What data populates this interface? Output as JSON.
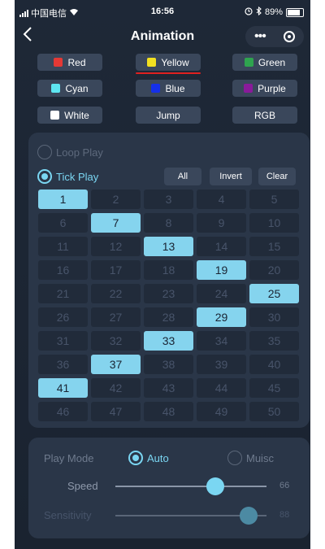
{
  "status": {
    "carrier": "中国电信",
    "time": "16:56",
    "battery": "89%"
  },
  "nav": {
    "title": "Animation"
  },
  "colors": [
    {
      "label": "Red",
      "swatch": "#e53935",
      "selected": false
    },
    {
      "label": "Yellow",
      "swatch": "#f2e020",
      "selected": true
    },
    {
      "label": "Green",
      "swatch": "#2fa44f",
      "selected": false
    },
    {
      "label": "Cyan",
      "swatch": "#5ee6f2",
      "selected": false
    },
    {
      "label": "Blue",
      "swatch": "#1530e8",
      "selected": false
    },
    {
      "label": "Purple",
      "swatch": "#8a1a9a",
      "selected": false
    },
    {
      "label": "White",
      "swatch": "#ffffff",
      "selected": false
    },
    {
      "label": "Jump",
      "swatch": "",
      "selected": false
    },
    {
      "label": "RGB",
      "swatch": "",
      "selected": false
    }
  ],
  "playback": {
    "loop_label": "Loop Play",
    "tick_label": "Tick Play",
    "selected": "tick",
    "all_label": "All",
    "invert_label": "Invert",
    "clear_label": "Clear"
  },
  "grid": {
    "cells": [
      "1",
      "2",
      "3",
      "4",
      "5",
      "6",
      "7",
      "8",
      "9",
      "10",
      "11",
      "12",
      "13",
      "14",
      "15",
      "16",
      "17",
      "18",
      "19",
      "20",
      "21",
      "22",
      "23",
      "24",
      "25",
      "26",
      "27",
      "28",
      "29",
      "30",
      "31",
      "32",
      "33",
      "34",
      "35",
      "36",
      "37",
      "38",
      "39",
      "40",
      "41",
      "42",
      "43",
      "44",
      "45",
      "46",
      "47",
      "48",
      "49",
      "50"
    ],
    "active": [
      1,
      7,
      13,
      19,
      25,
      29,
      33,
      37,
      41
    ]
  },
  "settings": {
    "play_mode_label": "Play Mode",
    "auto_label": "Auto",
    "music_label": "Muisc",
    "mode_selected": "auto",
    "speed_label": "Speed",
    "speed_value": "66",
    "speed_fraction": 0.66,
    "sensitivity_label": "Sensitivity",
    "sensitivity_value": "88",
    "sensitivity_fraction": 0.88
  }
}
